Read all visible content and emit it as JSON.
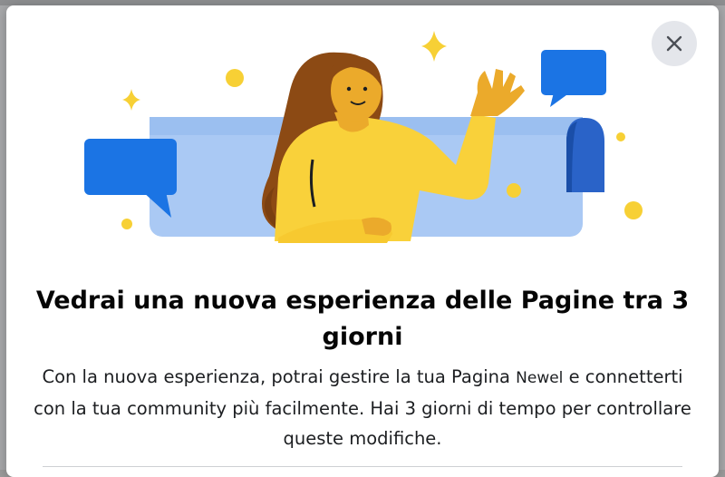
{
  "dialog": {
    "close_icon": "close-icon",
    "title": "Vedrai una nuova esperienza delle Pagine tra 3 giorni",
    "description_part1": "Con la nuova esperienza, potrai gestire la tua Pagina ",
    "page_name": "Newel",
    "description_part2": " e connetterti con la tua community più facilmente. Hai 3 giorni di tempo per controllare queste modifiche.",
    "illustration": "woman-waving-with-chat-bubbles-illustration"
  },
  "colors": {
    "dialog_bg": "#ffffff",
    "close_button_bg": "#e4e6eb",
    "bubble_blue": "#1b74e4",
    "banner_light_blue": "#aac9f4",
    "sparkle_yellow": "#f7d035",
    "shirt_yellow": "#f9d13a",
    "hair_brown": "#8c4a14",
    "skin": "#ebaa2b"
  }
}
